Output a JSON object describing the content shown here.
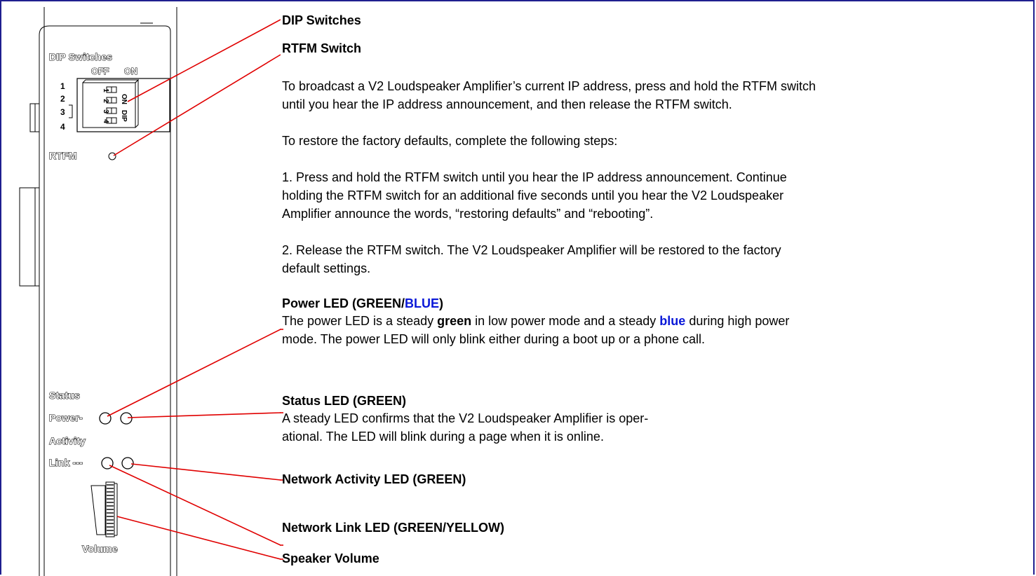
{
  "device": {
    "dip_title": "DIP Switches",
    "off_label": "OFF",
    "on_label": "ON",
    "dip_numbers": [
      "1",
      "2",
      "3",
      "4"
    ],
    "dip_body_on": "ON",
    "dip_body_dip": "DIP",
    "rtfm_label": "RTFM",
    "status_label": "Status",
    "power_label": "Power-",
    "activity_label": "Activity",
    "link_label": "Link ---",
    "volume_label": "Volume"
  },
  "callouts": {
    "dip": {
      "title": "DIP Switches"
    },
    "rtfm": {
      "title": "RTFM Switch",
      "lines": [
        "To broadcast a V2 Loudspeaker Amplifier’s current IP address, press and hold the RTFM switch",
        "until you hear the IP address announcement, and then release the RTFM switch.",
        "To restore the factory defaults, complete the following steps:",
        "1. Press and hold the RTFM switch until you hear the IP address announcement. Continue",
        "holding the RTFM switch for an additional five seconds until you hear the V2 Loudspeaker",
        "Amplifier announce the words, “restoring defaults” and “rebooting”.",
        "2. Release the RTFM switch. The V2 Loudspeaker Amplifier will be restored to the factory",
        "default settings."
      ]
    },
    "power": {
      "title_prefix": "Power LED (GREEN/",
      "title_blue": "BLUE",
      "title_suffix": ")",
      "line1_a": "The power LED is a steady ",
      "line1_green": "green",
      "line1_b": " in low power mode and a steady ",
      "line1_blue": "blue",
      "line1_c": " during high power",
      "line2": "mode. The power LED will only blink either during a boot up or a phone call."
    },
    "status": {
      "title": "Status LED (GREEN)",
      "lines": [
        "A steady LED confirms that the V2 Loudspeaker Amplifier is oper-",
        "ational. The LED will blink during a page when it is online."
      ]
    },
    "activity": {
      "title": "Network Activity LED (GREEN)"
    },
    "link": {
      "title": "Network Link LED (GREEN/YELLOW)"
    },
    "volume": {
      "title": "Speaker Volume"
    }
  },
  "colors": {
    "leader_line": "#e00000",
    "blue_text": "#0a18d8",
    "frame": "#1f1f8f"
  }
}
